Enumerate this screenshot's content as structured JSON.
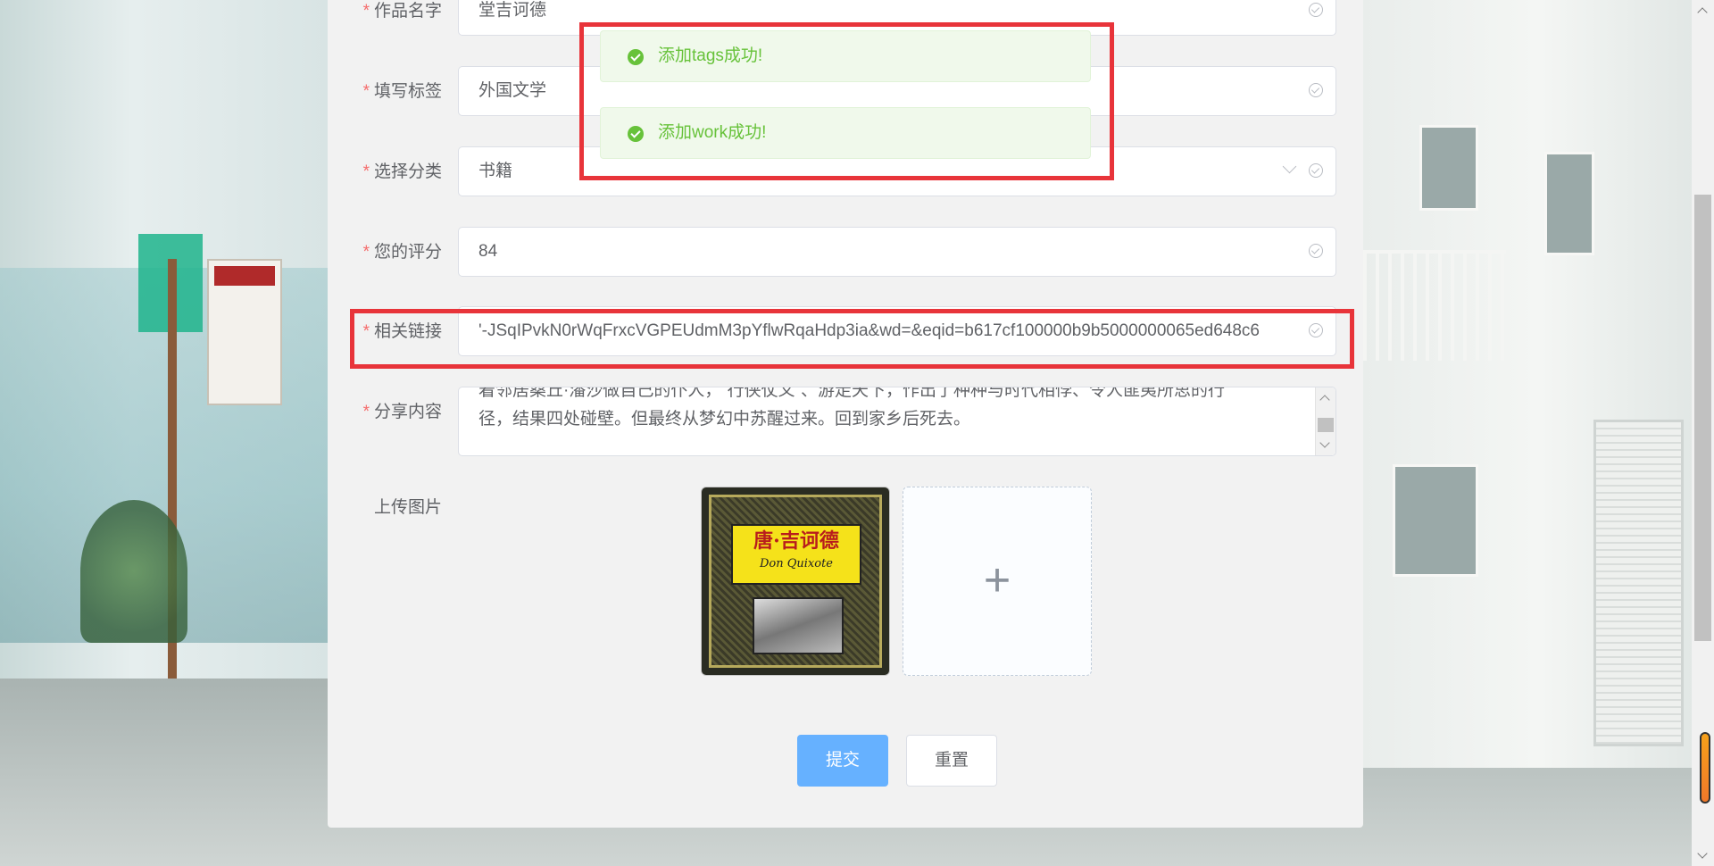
{
  "form": {
    "work_name": {
      "label": "作品名字",
      "value": "堂吉诃德"
    },
    "tags": {
      "label": "填写标签",
      "value": "外国文学"
    },
    "category": {
      "label": "选择分类",
      "value": "书籍"
    },
    "rating": {
      "label": "您的评分",
      "value": "84"
    },
    "link": {
      "label": "相关链接",
      "value": "'-JSqIPvkN0rWqFrxcVGPEUdmM3pYflwRqaHdp3ia&wd=&eqid=b617cf100000b9b5000000065ed648c6"
    },
    "share": {
      "label": "分享内容",
      "lines": [
        "着邻居桑丘·潘沙做自己的仆人，“行侠仗义”、游走天下，作出了种种与时代相悖、令人匪夷所思的行",
        "径，结果四处碰壁。但最终从梦幻中苏醒过来。回到家乡后死去。"
      ]
    },
    "upload": {
      "label": "上传图片",
      "plus": "+"
    },
    "required_mark": "*"
  },
  "book_cover": {
    "title": "唐·吉诃德",
    "subtitle": "Don Quixote"
  },
  "buttons": {
    "submit": "提交",
    "reset": "重置"
  },
  "notifications": [
    {
      "message": "添加tags成功!"
    },
    {
      "message": "添加work成功!"
    }
  ],
  "colors": {
    "success": "#67c23a",
    "primary": "#66b1ff",
    "required": "#f56c6c",
    "highlight": "#e8343a"
  }
}
